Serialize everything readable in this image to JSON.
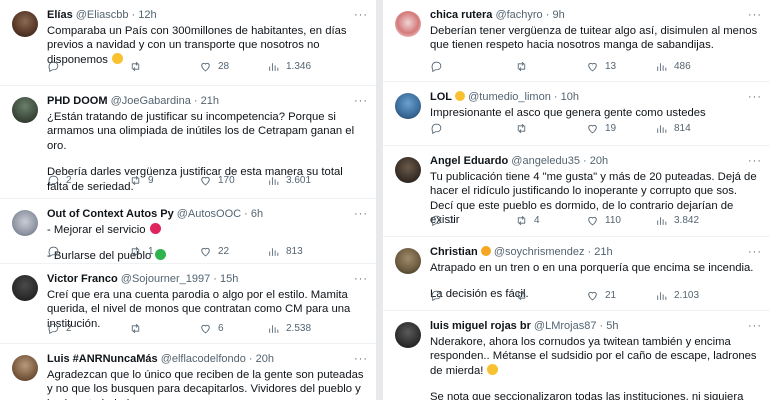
{
  "left": [
    {
      "name": "Elías",
      "handle": "@Eliascbb",
      "time": "12h",
      "lines": [
        "Comparaba un País con 300millones de habitantes, en días previos a navidad y con un transporte que nosotros no disponemos"
      ],
      "stats": {
        "replies": "",
        "retweets": "",
        "likes": "28",
        "views": "1.346"
      }
    },
    {
      "name": "PHD DOOM",
      "handle": "@JoeGabardina",
      "time": "21h",
      "lines": [
        "¿Están tratando de justificar su incompetencia? Porque si armamos una olimpiada de inútiles los de Cetrapam ganan el oro.",
        "Debería darles vergüenza justificar de esta manera su total falta de seriedad."
      ],
      "stats": {
        "replies": "2",
        "retweets": "9",
        "likes": "170",
        "views": "3.601"
      }
    },
    {
      "name": "Out of Context Autos Py",
      "handle": "@AutosOOC",
      "time": "6h",
      "lines": [
        "- Mejorar el servicio",
        "- Burlarse del pueblo"
      ],
      "stats": {
        "replies": "",
        "retweets": "1",
        "likes": "22",
        "views": "813"
      }
    },
    {
      "name": "Victor Franco",
      "handle": "@Sojourner_1997",
      "time": "15h",
      "lines": [
        "Creí que era una cuenta parodia o algo por el estilo. Mamita querida, el nivel de monos que contratan como CM para una institución."
      ],
      "stats": {
        "replies": "2",
        "retweets": "",
        "likes": "6",
        "views": "2.538"
      }
    },
    {
      "name": "Luis #ANRNuncaMás",
      "handle": "@elflacodelfondo",
      "time": "20h",
      "lines": [
        "Agradezcan que lo único que reciben de la gente son puteadas y no que los busquen para decapitarlos. Vividores del pueblo y la clase trabajadora."
      ],
      "stats": null
    }
  ],
  "right": [
    {
      "name": "chica rutera",
      "handle": "@fachyro",
      "time": "9h",
      "lines": [
        "Deberían tener vergüenza de tuitear algo así, disimulen al menos que tienen respeto hacia nosotros manga de sabandijas."
      ],
      "stats": {
        "replies": "",
        "retweets": "",
        "likes": "13",
        "views": "486"
      }
    },
    {
      "name": "LOL",
      "handle": "@tumedio_limon",
      "time": "10h",
      "lines": [
        "Impresionante el asco que genera gente como ustedes"
      ],
      "stats": {
        "replies": "",
        "retweets": "",
        "likes": "19",
        "views": "814"
      }
    },
    {
      "name": "Angel Eduardo",
      "handle": "@angeledu35",
      "time": "20h",
      "lines": [
        "Tu publicación tiene 4 \"me gusta\" y más de 20 puteadas. Dejá de hacer el ridículo justificando lo inoperante y corrupto que sos. Decí que este pueblo es dormido, de lo contrario dejarían de existir"
      ],
      "stats": {
        "replies": "1",
        "retweets": "4",
        "likes": "110",
        "views": "3.842"
      }
    },
    {
      "name": "Christian",
      "handle": "@soychrismendez",
      "time": "21h",
      "lines": [
        "Atrapado en un tren o en una porquería que encima se incendia.",
        "La decisión es fácil."
      ],
      "stats": {
        "replies": "",
        "retweets": "",
        "likes": "21",
        "views": "2.103"
      }
    },
    {
      "name": "luis miguel rojas br",
      "handle": "@LMrojas87",
      "time": "5h",
      "lines": [
        "Nderakore, ahora los cornudos ya twitean también y encima responden.. Métanse el sudsidio por el caño de escape, ladrones de mierda!",
        "Se nota que seccionalizaron todas las instituciones, ni siquiera con técnicos, sino con hurreros marginales"
      ],
      "stats": null
    }
  ],
  "colors": {
    "text": "#0f1419",
    "muted": "#536471",
    "border": "#eff3f4"
  }
}
